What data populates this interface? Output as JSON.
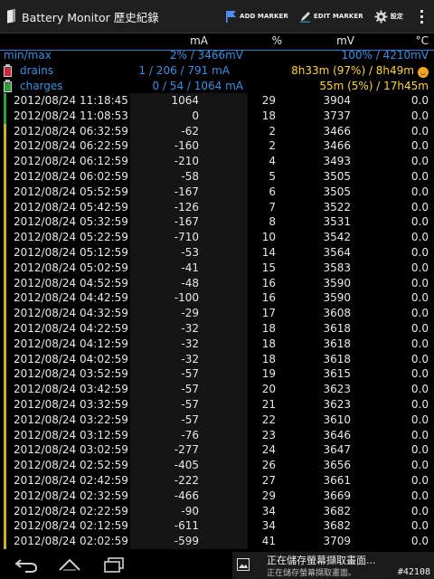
{
  "actionbar": {
    "title": "Battery Monitor 歷史紀錄",
    "add_marker": "ADD MARKER",
    "edit_marker": "EDIT MARKER",
    "settings": "設定"
  },
  "columns": {
    "ma": "mA",
    "pct": "%",
    "mv": "mV",
    "temp": "°C"
  },
  "minmax": {
    "label": "min/max",
    "left": "2% / 3466mV",
    "right": "100% / 4210mV"
  },
  "drains": {
    "label": "drains",
    "left": "1 / 206 / 791 mA",
    "right": "8h33m (97%) / 8h49m"
  },
  "charges": {
    "label": "charges",
    "left": "0 / 54 / 1064 mA",
    "right": "55m (5%) / 17h45m"
  },
  "colors": {
    "cyan": "#33b5e5",
    "yellow": "#ffd22e",
    "green": "#2e9e3a",
    "drain": "#c8283c"
  },
  "rows": [
    {
      "date": "2012/08/24",
      "time": "11:18:45",
      "ma": "1064",
      "pct": "29",
      "mv": "3904",
      "temp": "0.0",
      "state": "charge"
    },
    {
      "date": "2012/08/24",
      "time": "11:08:53",
      "ma": "0",
      "pct": "18",
      "mv": "3737",
      "temp": "0.0",
      "state": "charge"
    },
    {
      "date": "2012/08/24",
      "time": "06:32:59",
      "ma": "-62",
      "pct": "2",
      "mv": "3466",
      "temp": "0.0",
      "state": "drain"
    },
    {
      "date": "2012/08/24",
      "time": "06:22:59",
      "ma": "-160",
      "pct": "2",
      "mv": "3466",
      "temp": "0.0",
      "state": "drain"
    },
    {
      "date": "2012/08/24",
      "time": "06:12:59",
      "ma": "-210",
      "pct": "4",
      "mv": "3493",
      "temp": "0.0",
      "state": "drain"
    },
    {
      "date": "2012/08/24",
      "time": "06:02:59",
      "ma": "-58",
      "pct": "5",
      "mv": "3505",
      "temp": "0.0",
      "state": "drain"
    },
    {
      "date": "2012/08/24",
      "time": "05:52:59",
      "ma": "-167",
      "pct": "6",
      "mv": "3505",
      "temp": "0.0",
      "state": "drain"
    },
    {
      "date": "2012/08/24",
      "time": "05:42:59",
      "ma": "-126",
      "pct": "7",
      "mv": "3522",
      "temp": "0.0",
      "state": "drain"
    },
    {
      "date": "2012/08/24",
      "time": "05:32:59",
      "ma": "-167",
      "pct": "8",
      "mv": "3531",
      "temp": "0.0",
      "state": "drain"
    },
    {
      "date": "2012/08/24",
      "time": "05:22:59",
      "ma": "-710",
      "pct": "10",
      "mv": "3542",
      "temp": "0.0",
      "state": "drain"
    },
    {
      "date": "2012/08/24",
      "time": "05:12:59",
      "ma": "-53",
      "pct": "14",
      "mv": "3564",
      "temp": "0.0",
      "state": "drain"
    },
    {
      "date": "2012/08/24",
      "time": "05:02:59",
      "ma": "-41",
      "pct": "15",
      "mv": "3583",
      "temp": "0.0",
      "state": "drain"
    },
    {
      "date": "2012/08/24",
      "time": "04:52:59",
      "ma": "-48",
      "pct": "16",
      "mv": "3590",
      "temp": "0.0",
      "state": "drain"
    },
    {
      "date": "2012/08/24",
      "time": "04:42:59",
      "ma": "-100",
      "pct": "16",
      "mv": "3590",
      "temp": "0.0",
      "state": "drain"
    },
    {
      "date": "2012/08/24",
      "time": "04:32:59",
      "ma": "-29",
      "pct": "17",
      "mv": "3608",
      "temp": "0.0",
      "state": "drain"
    },
    {
      "date": "2012/08/24",
      "time": "04:22:59",
      "ma": "-32",
      "pct": "18",
      "mv": "3618",
      "temp": "0.0",
      "state": "drain"
    },
    {
      "date": "2012/08/24",
      "time": "04:12:59",
      "ma": "-32",
      "pct": "18",
      "mv": "3618",
      "temp": "0.0",
      "state": "drain"
    },
    {
      "date": "2012/08/24",
      "time": "04:02:59",
      "ma": "-32",
      "pct": "18",
      "mv": "3618",
      "temp": "0.0",
      "state": "drain"
    },
    {
      "date": "2012/08/24",
      "time": "03:52:59",
      "ma": "-57",
      "pct": "19",
      "mv": "3615",
      "temp": "0.0",
      "state": "drain"
    },
    {
      "date": "2012/08/24",
      "time": "03:42:59",
      "ma": "-57",
      "pct": "20",
      "mv": "3623",
      "temp": "0.0",
      "state": "drain"
    },
    {
      "date": "2012/08/24",
      "time": "03:32:59",
      "ma": "-57",
      "pct": "21",
      "mv": "3623",
      "temp": "0.0",
      "state": "drain"
    },
    {
      "date": "2012/08/24",
      "time": "03:22:59",
      "ma": "-57",
      "pct": "22",
      "mv": "3610",
      "temp": "0.0",
      "state": "drain"
    },
    {
      "date": "2012/08/24",
      "time": "03:12:59",
      "ma": "-76",
      "pct": "23",
      "mv": "3646",
      "temp": "0.0",
      "state": "drain"
    },
    {
      "date": "2012/08/24",
      "time": "03:02:59",
      "ma": "-277",
      "pct": "24",
      "mv": "3647",
      "temp": "0.0",
      "state": "drain"
    },
    {
      "date": "2012/08/24",
      "time": "02:52:59",
      "ma": "-405",
      "pct": "26",
      "mv": "3656",
      "temp": "0.0",
      "state": "drain"
    },
    {
      "date": "2012/08/24",
      "time": "02:42:59",
      "ma": "-222",
      "pct": "27",
      "mv": "3661",
      "temp": "0.0",
      "state": "drain"
    },
    {
      "date": "2012/08/24",
      "time": "02:32:59",
      "ma": "-466",
      "pct": "29",
      "mv": "3669",
      "temp": "0.0",
      "state": "drain"
    },
    {
      "date": "2012/08/24",
      "time": "02:22:59",
      "ma": "-90",
      "pct": "34",
      "mv": "3682",
      "temp": "0.0",
      "state": "drain"
    },
    {
      "date": "2012/08/24",
      "time": "02:12:59",
      "ma": "-611",
      "pct": "34",
      "mv": "3682",
      "temp": "0.0",
      "state": "drain"
    },
    {
      "date": "2012/08/24",
      "time": "02:02:59",
      "ma": "-599",
      "pct": "41",
      "mv": "3709",
      "temp": "0.0",
      "state": "drain"
    }
  ],
  "notification": {
    "title": "正在儲存螢幕擷取畫面...",
    "subtitle": "正在儲存螢幕擷取畫面。",
    "tag": "#42108"
  }
}
